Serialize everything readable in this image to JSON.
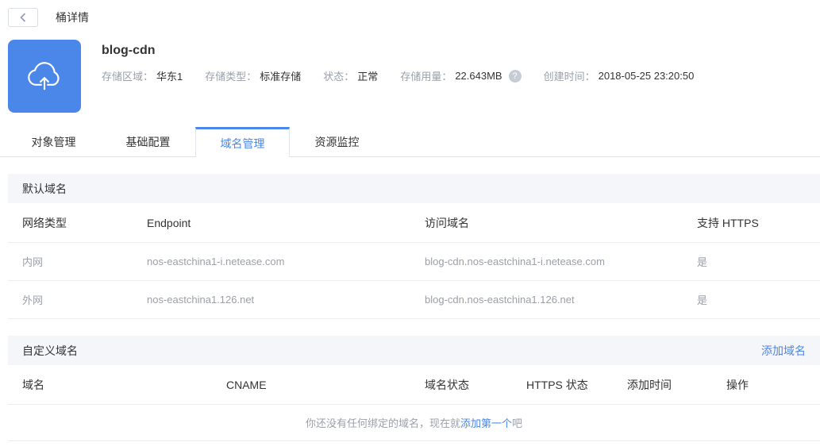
{
  "topbar": {
    "title": "桶详情"
  },
  "bucket": {
    "name": "blog-cdn",
    "info": [
      {
        "label": "存储区域：",
        "value": "华东1"
      },
      {
        "label": "存储类型：",
        "value": "标准存储"
      },
      {
        "label": "状态：",
        "value": "正常"
      },
      {
        "label": "存储用量：",
        "value": "22.643MB"
      },
      {
        "label": "创建时间：",
        "value": "2018-05-25 23:20:50"
      }
    ],
    "usage_help_icon": "?"
  },
  "tabs": [
    {
      "label": "对象管理"
    },
    {
      "label": "基础配置"
    },
    {
      "label": "域名管理"
    },
    {
      "label": "资源监控"
    }
  ],
  "default_domain": {
    "section_title": "默认域名",
    "columns": [
      "网络类型",
      "Endpoint",
      "访问域名",
      "支持 HTTPS"
    ],
    "rows": [
      [
        "内网",
        "nos-eastchina1-i.netease.com",
        "blog-cdn.nos-eastchina1-i.netease.com",
        "是"
      ],
      [
        "外网",
        "nos-eastchina1.126.net",
        "blog-cdn.nos-eastchina1.126.net",
        "是"
      ]
    ]
  },
  "custom_domain": {
    "section_title": "自定义域名",
    "add_link": "添加域名",
    "columns": [
      "域名",
      "CNAME",
      "域名状态",
      "HTTPS 状态",
      "添加时间",
      "操作"
    ],
    "empty": {
      "prefix": "你还没有任何绑定的域名，现在就",
      "link": "添加第一个",
      "suffix": "吧"
    }
  },
  "colors": {
    "accent": "#4a87e8",
    "text_dark": "#333333",
    "text_gray": "#9b9fa8",
    "section_bg": "#f5f6f9",
    "border": "#eceef3"
  }
}
